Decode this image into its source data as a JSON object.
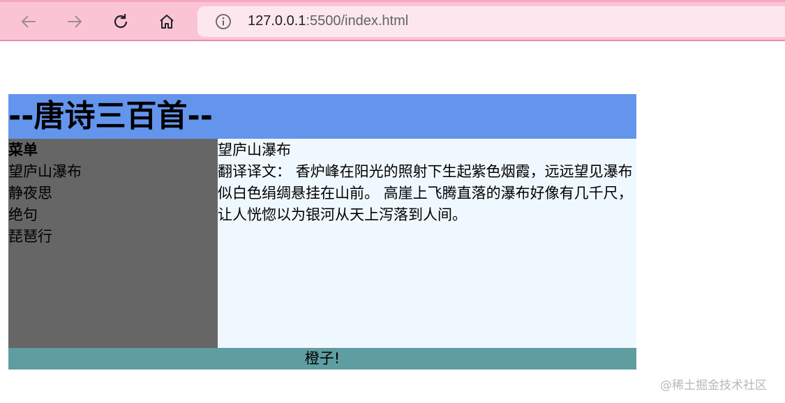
{
  "browser": {
    "url_host": "127.0.0.1",
    "url_path": ":5500/index.html",
    "toolbar_color": "#fbc4d4"
  },
  "page": {
    "header_title": "--唐诗三百首--",
    "menu": {
      "title": "菜单",
      "items": [
        "望庐山瀑布",
        "静夜思",
        "绝句",
        "琵琶行"
      ]
    },
    "content": {
      "title": "望庐山瀑布",
      "text": "翻译译文： 香炉峰在阳光的照射下生起紫色烟霞，远远望见瀑布似白色绢绸悬挂在山前。 高崖上飞腾直落的瀑布好像有几千尺，让人恍惚以为银河从天上泻落到人间。"
    },
    "footer_text": "橙子!",
    "colors": {
      "header": "#6495ed",
      "menu": "#666666",
      "content": "#f0f8ff",
      "footer": "#5f9ea0"
    }
  },
  "watermark": "@稀土掘金技术社区"
}
